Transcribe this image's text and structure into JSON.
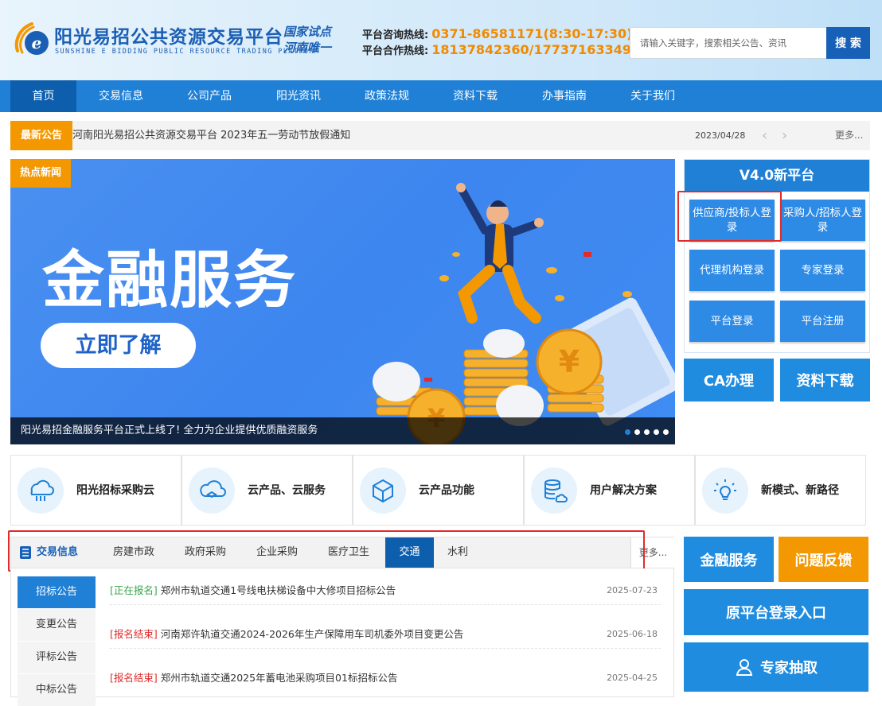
{
  "header": {
    "title": "阳光易招公共资源交易平台",
    "subtitle": "SUNSHINE E BIDDING PUBLIC RESOURCE TRADING PLATFORM",
    "tagline_1": "国家试点",
    "tagline_2": "河南唯一",
    "hotline_label": "平台咨询热线:",
    "hotline_number": "0371-86581171(8:30-17:30)",
    "coop_label": "平台合作热线:",
    "coop_number": "18137842360/17737163349",
    "search_placeholder": "请输入关键字，搜索相关公告、资讯",
    "search_button": "搜 索"
  },
  "nav": [
    "首页",
    "交易信息",
    "公司产品",
    "阳光资讯",
    "政策法规",
    "资料下载",
    "办事指南",
    "关于我们"
  ],
  "notice": {
    "tag": "最新公告",
    "text": "河南阳光易招公共资源交易平台 2023年五一劳动节放假通知",
    "date": "2023/04/28",
    "more": "更多..."
  },
  "banner": {
    "tag": "热点新闻",
    "title": "金融服务",
    "button": "立即了解",
    "caption": "阳光易招金融服务平台正式上线了! 全力为企业提供优质融资服务",
    "slide_count": 5,
    "active_slide": 0
  },
  "v4": {
    "title": "V4.0新平台",
    "buttons": [
      "供应商/投标人登录",
      "采购人/招标人登录",
      "代理机构登录",
      "专家登录",
      "平台登录",
      "平台注册"
    ]
  },
  "quick": {
    "ca": "CA办理",
    "download": "资料下载",
    "finance": "金融服务",
    "feedback": "问题反馈",
    "old_entry": "原平台登录入口",
    "expert": "专家抽取"
  },
  "services": [
    "阳光招标采购云",
    "云产品、云服务",
    "云产品功能",
    "用户解决方案",
    "新模式、新路径"
  ],
  "trade": {
    "title": "交易信息",
    "tabs": [
      "房建市政",
      "政府采购",
      "企业采购",
      "医疗卫生",
      "交通",
      "水利"
    ],
    "active_tab": "交通",
    "more": "更多...",
    "side_tabs": [
      "招标公告",
      "变更公告",
      "评标公告",
      "中标公告"
    ],
    "rows": [
      {
        "status": "[正在报名]",
        "title": "郑州市轨道交通1号线电扶梯设备中大修项目招标公告",
        "date": "2025-07-23"
      },
      {
        "status": "[报名结束]",
        "title": "河南郑许轨道交通2024-2026年生产保障用车司机委外项目变更公告",
        "date": "2025-06-18"
      },
      {
        "status": "[报名结束]",
        "title": "郑州市轨道交通2025年蓄电池采购项目01标招标公告",
        "date": "2025-04-25"
      }
    ]
  },
  "colors": {
    "primary": "#1f80d6",
    "accent": "#f39800",
    "highlight": "#e02b2b"
  }
}
